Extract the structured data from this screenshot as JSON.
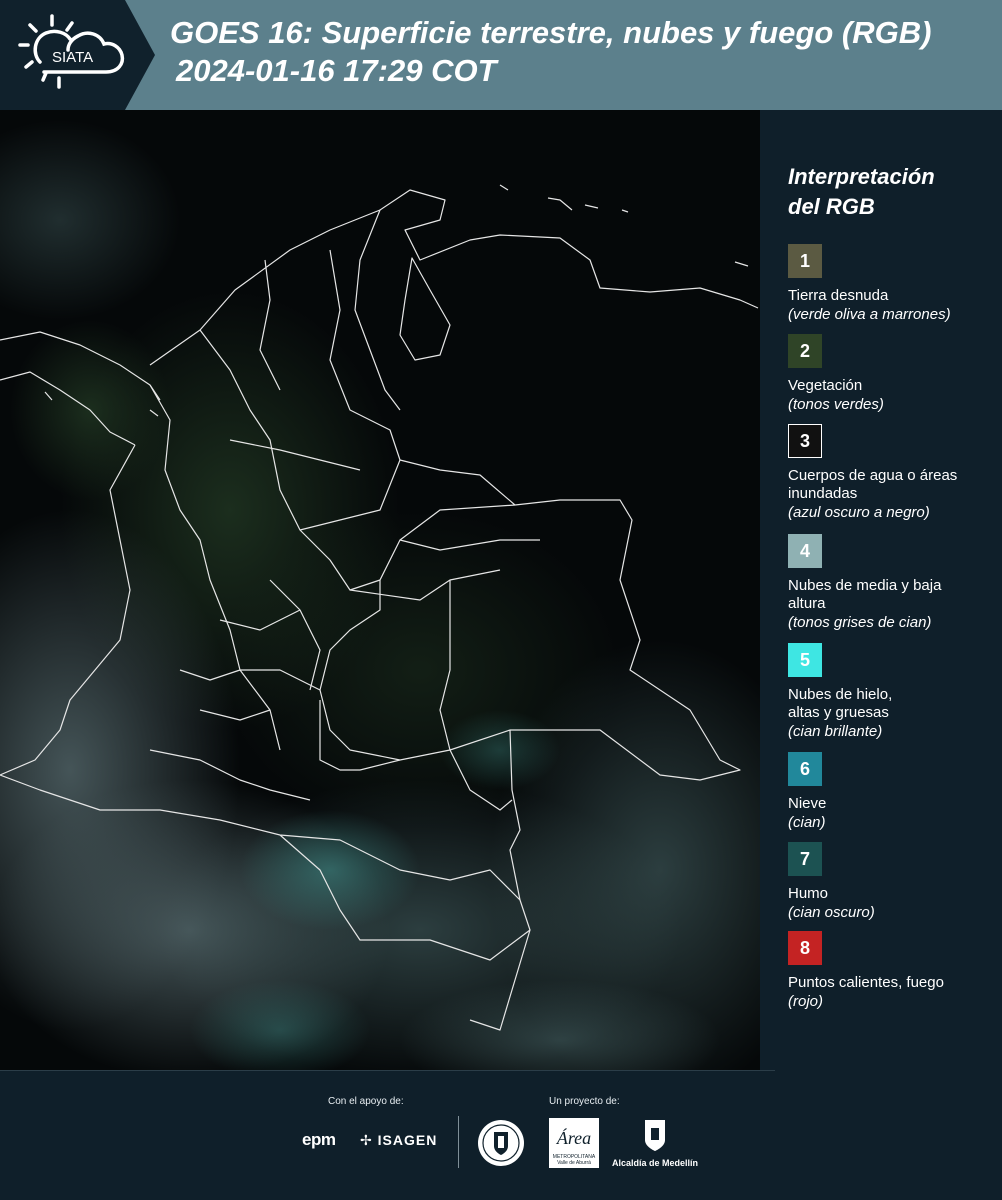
{
  "header": {
    "logo_text": "SIATA",
    "title_line1": "GOES 16: Superficie terrestre, nubes y fuego (RGB)",
    "title_line2": "2024-01-16 17:29 COT"
  },
  "legend": {
    "title_line1": "Interpretación",
    "title_line2": "del RGB",
    "items": [
      {
        "number": "1",
        "label": "Tierra desnuda",
        "description": "(verde oliva a marrones)",
        "color": "#5b5a42"
      },
      {
        "number": "2",
        "label": "Vegetación",
        "description": "(tonos verdes)",
        "color": "#2f4427"
      },
      {
        "number": "3",
        "label": "Cuerpos de agua o áreas inundadas",
        "description": "(azul oscuro a negro)",
        "color": "#111111"
      },
      {
        "number": "4",
        "label": "Nubes de media y baja altura",
        "description": "(tonos grises de cian)",
        "color": "#8fb1b3"
      },
      {
        "number": "5",
        "label": "Nubes de hielo, altas y gruesas",
        "description": "(cian brillante)",
        "color": "#3ee6e3"
      },
      {
        "number": "6",
        "label": "Nieve",
        "description": "(cian)",
        "color": "#21889b"
      },
      {
        "number": "7",
        "label": "Humo",
        "description": "(cian oscuro)",
        "color": "#1c5252"
      },
      {
        "number": "8",
        "label": "Puntos calientes, fuego",
        "description": "(rojo)",
        "color": "#c42323"
      }
    ]
  },
  "footer": {
    "support_label": "Con el apoyo de:",
    "project_label": "Un proyecto de:",
    "sponsor_1": "epm",
    "sponsor_2": "ISAGEN",
    "area_name": "Área",
    "area_subtitle": "METROPOLITANA Valle de Aburrá",
    "alcaldia": "Alcaldía de Medellín"
  }
}
